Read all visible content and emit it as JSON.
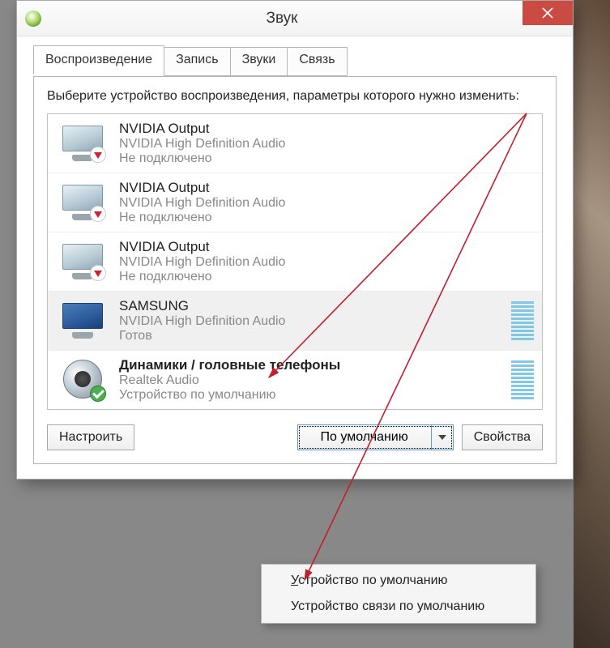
{
  "window": {
    "title": "Звук"
  },
  "tabs": [
    {
      "label": "Воспроизведение",
      "active": true
    },
    {
      "label": "Запись",
      "active": false
    },
    {
      "label": "Звуки",
      "active": false
    },
    {
      "label": "Связь",
      "active": false
    }
  ],
  "instructions": "Выберите устройство воспроизведения, параметры которого нужно изменить:",
  "devices": [
    {
      "name": "NVIDIA Output",
      "driver": "NVIDIA High Definition Audio",
      "status": "Не подключено",
      "icon": "monitor",
      "badge": "down",
      "bold": false,
      "selected": false,
      "levels": false
    },
    {
      "name": "NVIDIA Output",
      "driver": "NVIDIA High Definition Audio",
      "status": "Не подключено",
      "icon": "monitor",
      "badge": "down",
      "bold": false,
      "selected": false,
      "levels": false
    },
    {
      "name": "NVIDIA Output",
      "driver": "NVIDIA High Definition Audio",
      "status": "Не подключено",
      "icon": "monitor",
      "badge": "down",
      "bold": false,
      "selected": false,
      "levels": false
    },
    {
      "name": "SAMSUNG",
      "driver": "NVIDIA High Definition Audio",
      "status": "Готов",
      "icon": "monitor-blue",
      "badge": null,
      "bold": false,
      "selected": true,
      "levels": true
    },
    {
      "name": "Динамики / головные телефоны",
      "driver": "Realtek Audio",
      "status": "Устройство по умолчанию",
      "icon": "speaker",
      "badge": "check",
      "bold": true,
      "selected": false,
      "levels": true
    }
  ],
  "buttons": {
    "configure": "Настроить",
    "set_default": "По умолчанию",
    "properties": "Свойства"
  },
  "dropdown": [
    {
      "label_pre": "",
      "label_u": "У",
      "label_post": "стройство по умолчанию"
    },
    {
      "label_pre": "Устройство связи по умолчанию",
      "label_u": "",
      "label_post": ""
    }
  ],
  "colors": {
    "close_btn": "#c94b42",
    "annotation": "#c01f2b"
  }
}
